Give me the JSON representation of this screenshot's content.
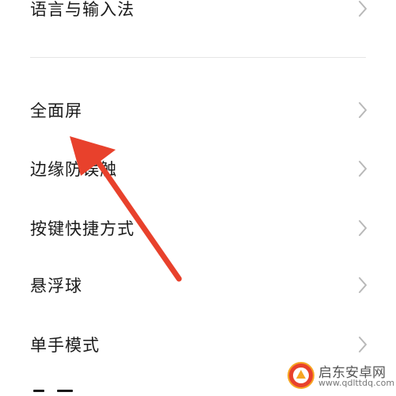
{
  "settings": {
    "items": [
      {
        "label": "语言与输入法"
      },
      {
        "label": "全面屏"
      },
      {
        "label": "边缘防误触"
      },
      {
        "label": "按键快捷方式"
      },
      {
        "label": "悬浮球"
      },
      {
        "label": "单手模式"
      }
    ]
  },
  "annotation": {
    "arrow_color": "#e8412c",
    "icon": "arrow-pointing-icon"
  },
  "watermark": {
    "name": "启东安卓网",
    "url": "www.qdlttdq.com",
    "logo_color": "#e8412c"
  },
  "colors": {
    "text": "#1a1a1a",
    "chevron": "#b8b8b8",
    "divider": "#e6e6e6",
    "background": "#ffffff"
  }
}
